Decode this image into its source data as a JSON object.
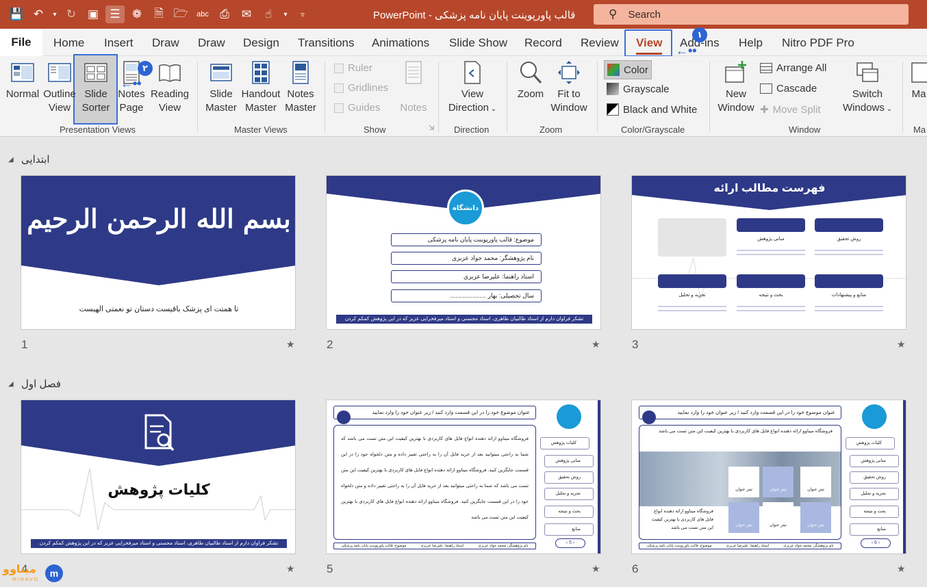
{
  "titlebar": {
    "doc_title": "قالب پاورپوینت پایان نامه پزشکی  -  PowerPoint",
    "search_placeholder": "Search"
  },
  "tabs": [
    "File",
    "Home",
    "Insert",
    "Draw",
    "Draw",
    "Design",
    "Transitions",
    "Animations",
    "Slide Show",
    "Record",
    "Review",
    "View",
    "Add-ins",
    "Help",
    "Nitro PDF Pro"
  ],
  "ribbon": {
    "presentation_views": {
      "label": "Presentation Views",
      "normal": "Normal",
      "outline": [
        "Outline",
        "View"
      ],
      "slide_sorter": [
        "Slide",
        "Sorter"
      ],
      "notes_page": [
        "Notes",
        "Page"
      ],
      "reading": [
        "Reading",
        "View"
      ]
    },
    "master_views": {
      "label": "Master Views",
      "slide_master": [
        "Slide",
        "Master"
      ],
      "handout_master": [
        "Handout",
        "Master"
      ],
      "notes_master": [
        "Notes",
        "Master"
      ]
    },
    "show": {
      "label": "Show",
      "ruler": "Ruler",
      "gridlines": "Gridlines",
      "guides": "Guides",
      "notes": "Notes"
    },
    "direction": {
      "label": "Direction",
      "view_direction": [
        "View",
        "Direction"
      ]
    },
    "zoom": {
      "label": "Zoom",
      "zoom": "Zoom",
      "fit": [
        "Fit to",
        "Window"
      ]
    },
    "color": {
      "label": "Color/Grayscale",
      "color": "Color",
      "grayscale": "Grayscale",
      "bw": "Black and White"
    },
    "window": {
      "label": "Window",
      "new_window": [
        "New",
        "Window"
      ],
      "arrange_all": "Arrange All",
      "cascade": "Cascade",
      "move_split": "Move Split",
      "switch": [
        "Switch",
        "Windows"
      ]
    },
    "macros": {
      "label": "Ma",
      "btn": "Ma"
    }
  },
  "annotations": {
    "badge1": "۱",
    "badge2": "۲"
  },
  "sections": [
    {
      "name": "ابتدایی"
    },
    {
      "name": "فصل اول"
    }
  ],
  "slides": {
    "s1": {
      "num": "1",
      "title": "بسم الله الرحمن الرحیم",
      "subtitle": "تا همتت ای پزشک باقیست دستان تو نعمتی الهیست"
    },
    "s2": {
      "num": "2",
      "logo": "دانشگاه",
      "fields": [
        "موضوع: قالب پاورپوینت پایان نامه پزشکی",
        "نام پژوهشگر: محمد جواد عزیزی",
        "استاد راهنما: علیرضا عزیزی",
        "سال تحصیلی: بهار ....................."
      ],
      "footer": "تشکر فراوان دارم از استاد طالبیان طاهری، استاد محسنی و استاد میرفخرایی عزیز که در این پژوهش کمکم کردن"
    },
    "s3": {
      "num": "3",
      "title": "فهرست مطالب ارائه",
      "cards": [
        "مبانی پژوهش",
        "روش تحقیق",
        "تجزیه و تحلیل",
        "بحث و نتیجه",
        "منابع و پیشنهادات"
      ]
    },
    "s4": {
      "num": "4",
      "title": "کلیات پژوهش",
      "footer": "تشکر فراوان دارم از استاد طالبیان طاهری، استاد محسنی و استاد میرفخرایی عزیز که در این پژوهش کمکم کردن"
    },
    "s5": {
      "num": "5",
      "header": "عنوان موضوع خود را در این قسمت وارد کنید  /  زیر عنوان خود را وارد نمایید",
      "body": "فروشگاه میناوو ارائه دهنده انواع فایل های کاربردی با بهترین کیفیت این متن تست می باشد  که شما به راحتی میتوانید بعد از خرید فایل آن را به راحتی تغییر داده و متن دلخواه خود را در این قسمت جایگزین کنید. فروشگاه میناوو ارائه دهنده انواع فایل های کاربردی با بهترین کیفیت این متن تست می باشد  که شما به راحتی میتوانید بعد از خرید فایل آن را به راحتی تغییر داده و متن دلخواه خود را در این قسمت جایگزین کنید. فروشگاه میناوو ارائه دهنده انواع فایل های کاربردی با بهترین کیفیت این متن تست می باشد",
      "side": [
        "کلیات پژوهش",
        "مبانی پژوهش",
        "روش تحقیق",
        "تجزیه و تحلیل",
        "بحث و نتیجه",
        "منابع"
      ],
      "page": "5",
      "foot": [
        "نام پژوهشگر: محمد جواد عزیزی",
        "استاد راهنما: علیرضا عزیزی",
        "موضوع: قالب پاورپوینت پایان نامه پزشکی"
      ]
    },
    "s6": {
      "num": "6",
      "header": "عنوان موضوع خود را در این قسمت وارد کنید  /  زیر عنوان خود را وارد نمایید",
      "intro": "فروشگاه میناوو ارائه دهنده انواع فایل های کاربردی با بهترین کیفیت این متن تست می باشد",
      "body": "فروشگاه میناوو ارائه دهنده انواع فایل های کاربردی با بهترین کیفیت این متن تست می باشد",
      "tile": "تیتر عنوان",
      "side": [
        "کلیات پژوهش",
        "مبانی پژوهش",
        "روش تحقیق",
        "تجزیه و تحلیل",
        "بحث و نتیجه",
        "منابع"
      ],
      "page": "6",
      "foot": [
        "نام پژوهشگر: محمد جواد عزیزی",
        "استاد راهنما: علیرضا عزیزی",
        "موضوع: قالب پاورپوینت پایان نامه پزشکی"
      ]
    }
  },
  "watermark": {
    "text": "میناوو",
    "sub": "MINAVO"
  },
  "colors": {
    "accent": "#b7472a",
    "navy": "#2e3a87",
    "annot": "#2d63d2"
  }
}
